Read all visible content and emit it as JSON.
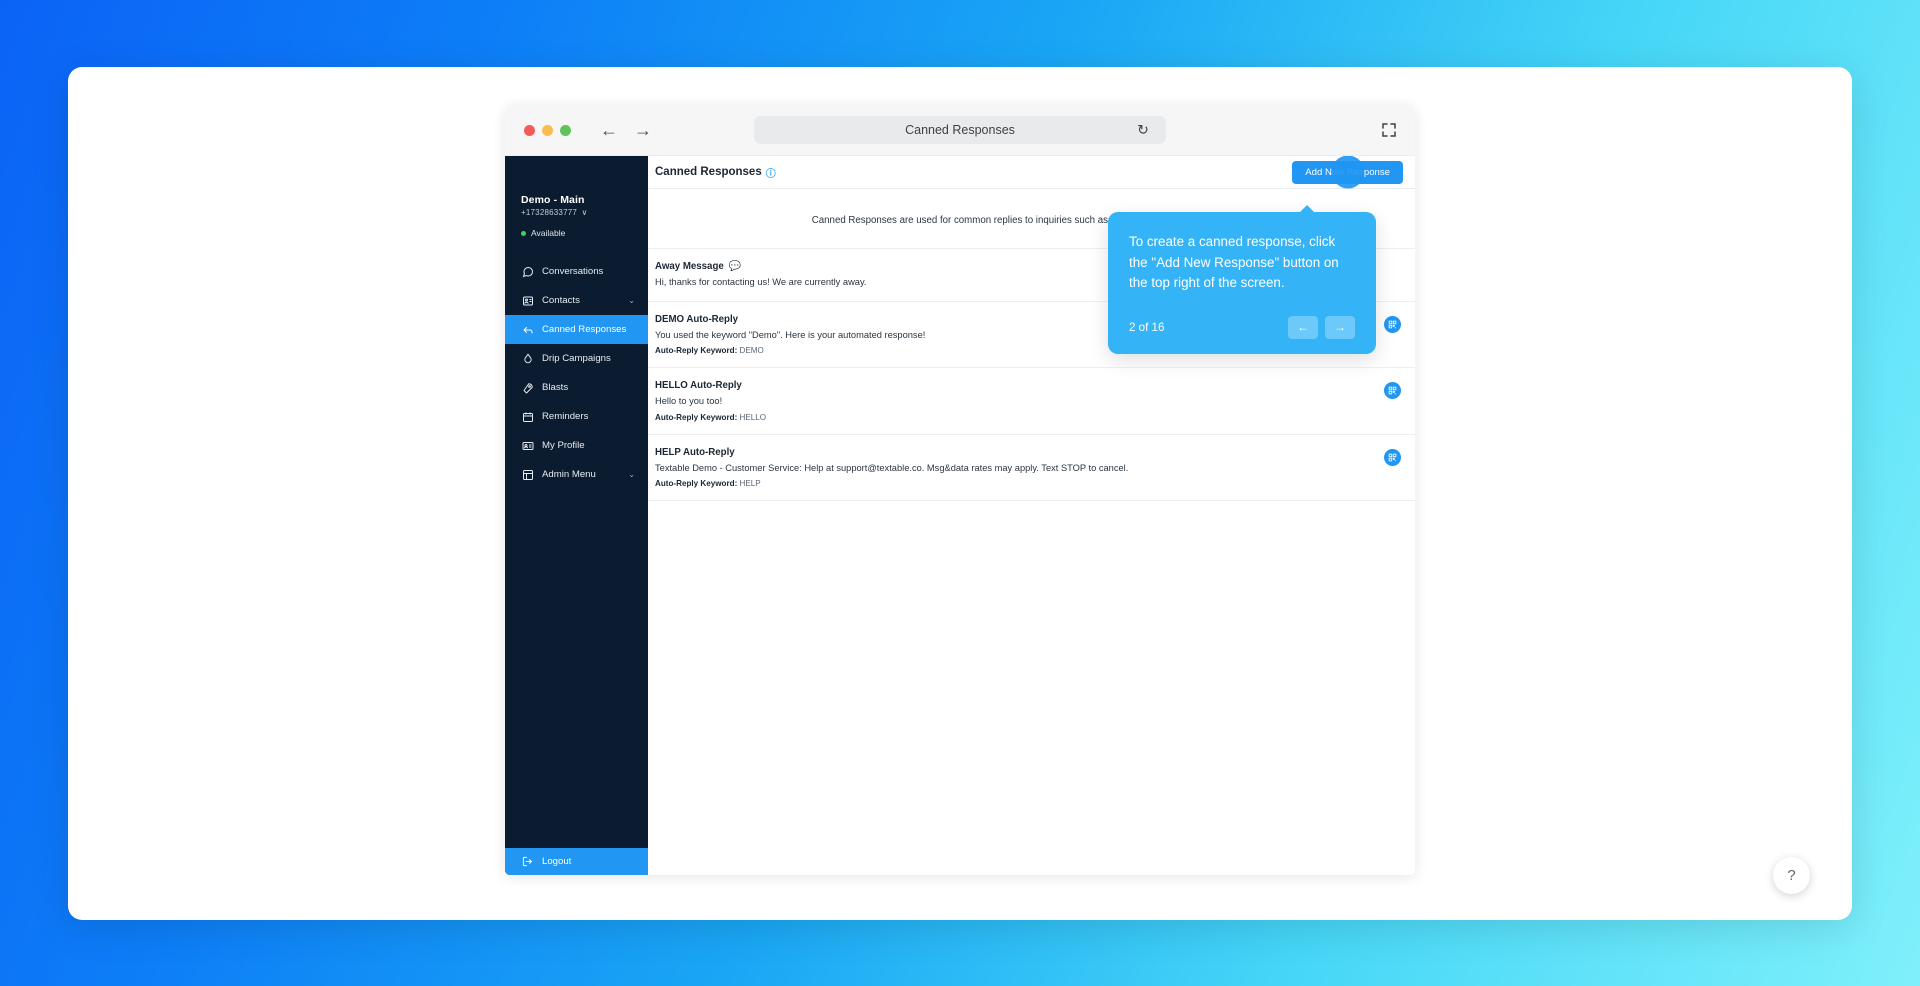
{
  "browser": {
    "title": "Canned Responses",
    "back_icon": "arrow-left-icon",
    "forward_icon": "arrow-right-icon",
    "reload_icon": "reload-icon",
    "expand_icon": "expand-icon"
  },
  "sidebar": {
    "account_name": "Demo - Main",
    "account_phone": "+17328633777",
    "chevron": "∨",
    "status": "Available",
    "items": [
      {
        "label": "Conversations",
        "icon": "chat-icon",
        "active": false,
        "expandable": false
      },
      {
        "label": "Contacts",
        "icon": "contact-card-icon",
        "active": false,
        "expandable": true
      },
      {
        "label": "Canned Responses",
        "icon": "reply-icon",
        "active": true,
        "expandable": false
      },
      {
        "label": "Drip Campaigns",
        "icon": "droplet-icon",
        "active": false,
        "expandable": false
      },
      {
        "label": "Blasts",
        "icon": "rocket-icon",
        "active": false,
        "expandable": false
      },
      {
        "label": "Reminders",
        "icon": "calendar-icon",
        "active": false,
        "expandable": false
      },
      {
        "label": "My Profile",
        "icon": "id-badge-icon",
        "active": false,
        "expandable": false
      },
      {
        "label": "Admin Menu",
        "icon": "admin-panel-icon",
        "active": false,
        "expandable": true
      }
    ],
    "logout_label": "Logout",
    "logout_icon": "logout-icon"
  },
  "main": {
    "page_title": "Canned Responses",
    "help_icon": "question-circle-icon",
    "add_button_label": "Add New Response",
    "intro_text": "Canned Responses are used for common replies to inquiries such as hours, address, and contact info.",
    "responses": [
      {
        "title": "Away Message",
        "title_icon": "chat-bubble-icon",
        "body": "Hi, thanks for contacting us! We are currently away.",
        "keyword_label": "",
        "keyword_value": "",
        "action_icon": ""
      },
      {
        "title": "DEMO Auto-Reply",
        "title_icon": "",
        "body": "You used the keyword \"Demo\". Here is your automated response!",
        "keyword_label": "Auto-Reply Keyword:",
        "keyword_value": "DEMO",
        "action_icon": "qr-code-icon"
      },
      {
        "title": "HELLO Auto-Reply",
        "title_icon": "",
        "body": "Hello to you too!",
        "keyword_label": "Auto-Reply Keyword:",
        "keyword_value": "HELLO",
        "action_icon": "qr-code-icon"
      },
      {
        "title": "HELP Auto-Reply",
        "title_icon": "",
        "body": "Textable Demo - Customer Service: Help at support@textable.co. Msg&data rates may apply. Text STOP to cancel.",
        "keyword_label": "Auto-Reply Keyword:",
        "keyword_value": "HELP",
        "action_icon": "qr-code-icon"
      }
    ]
  },
  "coachmark": {
    "text": "To create a canned response, click the \"Add New Response\" button on the top right of the screen.",
    "counter": "2 of 16",
    "prev_icon": "←",
    "next_icon": "→",
    "accent": "#34b4f7"
  },
  "help_fab": {
    "label": "?"
  },
  "colors": {
    "accent": "#2196f3",
    "sidebar_bg": "#0b1c30",
    "coach_bg": "#34b4f7"
  }
}
